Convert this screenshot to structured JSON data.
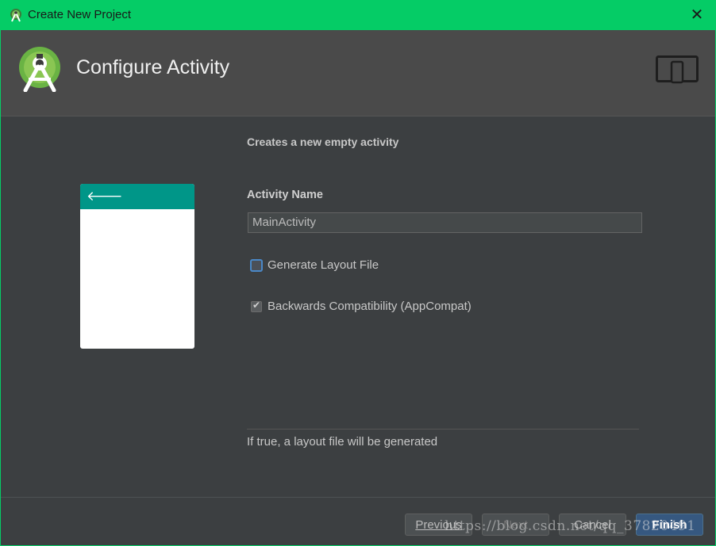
{
  "window": {
    "title": "Create New Project"
  },
  "header": {
    "heading": "Configure Activity"
  },
  "main": {
    "subtitle": "Creates a new empty activity",
    "activity_name_label": "Activity Name",
    "activity_name_value": "MainActivity",
    "generate_layout_label": "Generate Layout File",
    "generate_layout_checked": false,
    "backwards_compat_label": "Backwards Compatibility (AppCompat)",
    "backwards_compat_checked": true,
    "help_text": "If true, a layout file will be generated"
  },
  "footer": {
    "previous_label": "Previous",
    "next_label": "Next",
    "cancel_label": "Cancel",
    "finish_label": "Finish"
  },
  "watermark": "https://blog.csdn.net/qq_37820491",
  "colors": {
    "titlebar": "#05cc66",
    "background": "#3c3f41",
    "appbar": "#009688",
    "primary_button": "#365880"
  }
}
